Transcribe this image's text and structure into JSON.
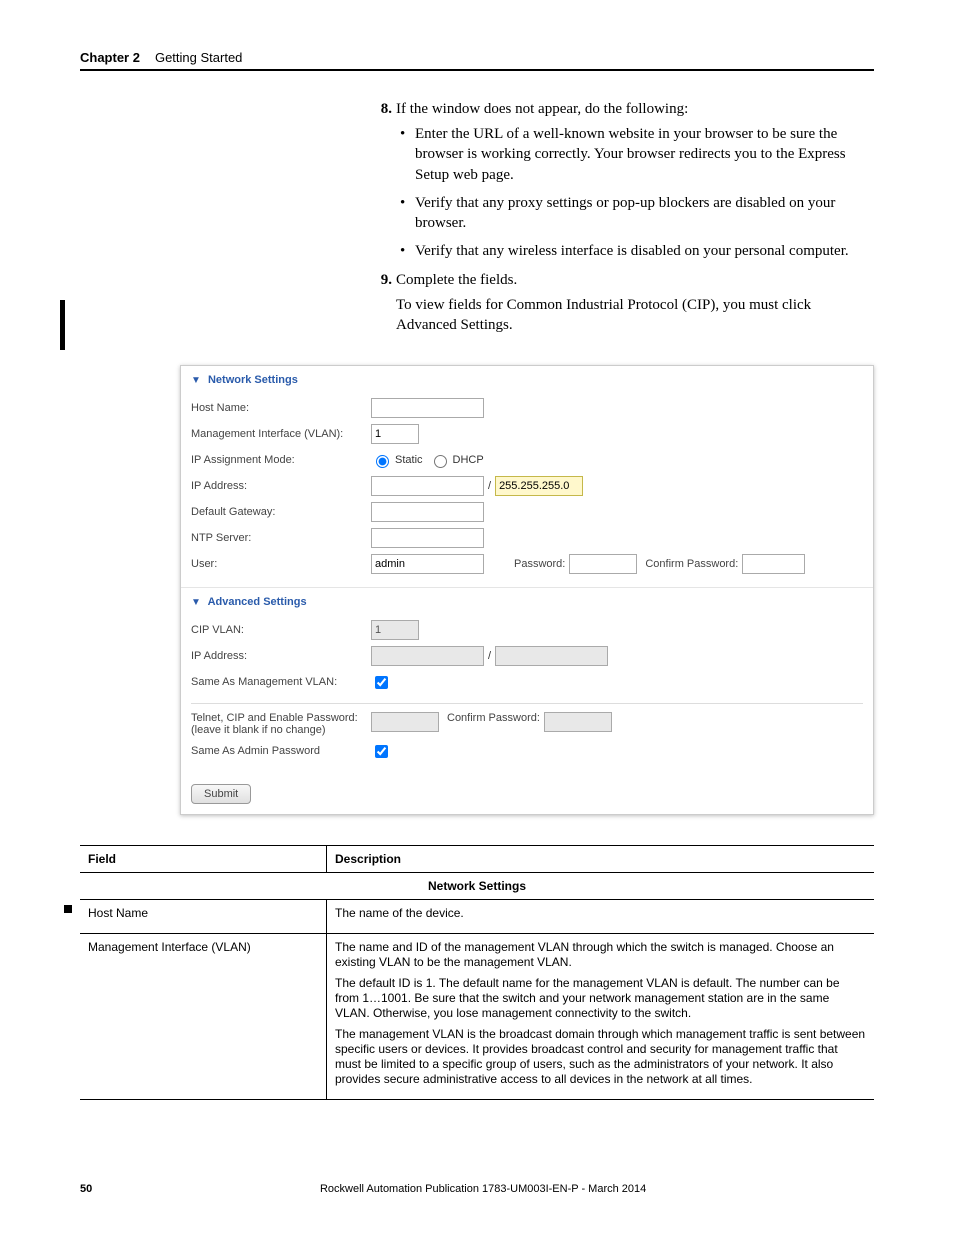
{
  "header": {
    "chapter": "Chapter 2",
    "title": "Getting Started"
  },
  "steps": {
    "s8": {
      "num": "8.",
      "text": "If the window does not appear, do the following:"
    },
    "bullets": [
      "Enter the URL of a well-known website in your browser to be sure the browser is working correctly. Your browser redirects you to the Express Setup web page.",
      "Verify that any proxy settings or pop-up blockers are disabled on your browser.",
      "Verify that any wireless interface is disabled on your personal computer."
    ],
    "s9": {
      "num": "9.",
      "text": "Complete the fields."
    },
    "s9_sub": "To view fields for Common Industrial Protocol (CIP), you must click Advanced Settings."
  },
  "panel": {
    "net_title": "Network Settings",
    "adv_title": "Advanced Settings",
    "labels": {
      "host": "Host Name:",
      "mgmt": "Management Interface (VLAN):",
      "ipmode": "IP Assignment Mode:",
      "ipaddr": "IP Address:",
      "gateway": "Default Gateway:",
      "ntp": "NTP Server:",
      "user": "User:",
      "password": "Password:",
      "confirm_pw": "Confirm Password:",
      "cipvlan": "CIP VLAN:",
      "ipaddr2": "IP Address:",
      "same_mgmt": "Same As Management VLAN:",
      "telnet": "Telnet, CIP and Enable Password:",
      "telnet_sub": "(leave it blank if no change)",
      "same_admin": "Same As Admin Password"
    },
    "values": {
      "mgmt": "1",
      "static": "Static",
      "dhcp": "DHCP",
      "mask": "255.255.255.0",
      "user": "admin",
      "cipvlan": "1",
      "submit": "Submit"
    }
  },
  "table": {
    "h_field": "Field",
    "h_desc": "Description",
    "subhead": "Network Settings",
    "rows": [
      {
        "f": "Host Name",
        "d": [
          "The name of the device."
        ]
      },
      {
        "f": "Management Interface (VLAN)",
        "d": [
          "The name and ID of the management VLAN through which the switch is managed. Choose an existing VLAN to be the management VLAN.",
          "The default ID is 1. The default name for the management VLAN is default. The number can be from 1…1001. Be sure that the switch and your network management station are in the same VLAN. Otherwise, you lose management connectivity to the switch.",
          "The management VLAN is the broadcast domain through which management traffic is sent between specific users or devices. It provides broadcast control and security for management traffic that must be limited to a specific group of users, such as the administrators of your network. It also provides secure administrative access to all devices in the network at all times."
        ]
      }
    ]
  },
  "footer": {
    "page": "50",
    "pub": "Rockwell Automation Publication 1783-UM003I-EN-P - March 2014"
  }
}
